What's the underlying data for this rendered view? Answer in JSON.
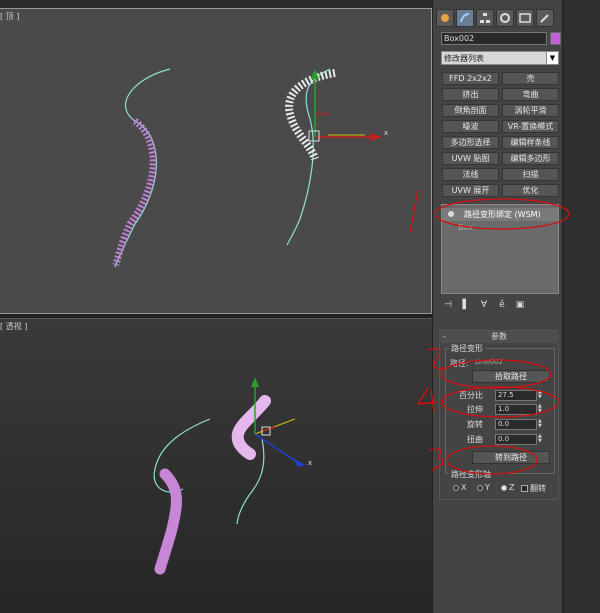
{
  "viewport_top": {
    "label": "[ 顶 ]"
  },
  "viewport_bottom": {
    "label": "[ 透视 ]"
  },
  "axis_x_top": "x",
  "axis_x_bottom": "x",
  "object": {
    "name": "Box002",
    "color": "#c25fd2"
  },
  "modifier_list": {
    "label": "修改器列表"
  },
  "modifier_buttons": [
    "FFD 2x2x2",
    "壳",
    "挤出",
    "弯曲",
    "倒角剖面",
    "涡轮平滑",
    "噪波",
    "VR-置换模式",
    "多边形选择",
    "编辑样条线",
    "UVW 贴图",
    "编辑多边形",
    "法线",
    "扫描",
    "UVW 展开",
    "优化"
  ],
  "stack": {
    "modifier": "路径变形绑定 (WSM)",
    "base": "Box"
  },
  "params": {
    "rollout_title": "参数",
    "group_title": "路径变形",
    "path_label": "路径:",
    "path_value": "Line002",
    "pick_path": "拾取路径",
    "percent_label": "百分比",
    "percent_value": "27.5",
    "stretch_label": "拉伸",
    "stretch_value": "1.0",
    "rotation_label": "旋转",
    "rotation_value": "0.0",
    "twist_label": "扭曲",
    "twist_value": "0.0",
    "move_to_path": "转到路径",
    "axis_group": "路径变形轴",
    "axis_x": "X",
    "axis_y": "Y",
    "axis_z": "Z",
    "axis_selected": "Z",
    "flip": "翻转"
  },
  "annotations": [
    "1",
    "2",
    "3",
    "4"
  ]
}
